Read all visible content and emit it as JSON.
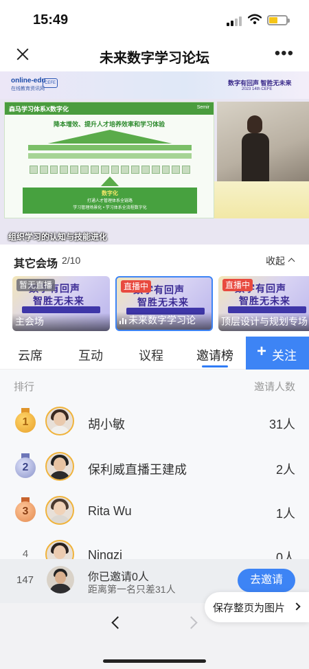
{
  "status_bar": {
    "time": "15:49"
  },
  "nav": {
    "title": "未来数字学习论坛",
    "more_label": "•••"
  },
  "video": {
    "logo": "online-edu",
    "logo_sub": "在线教育资讯网",
    "logo_badge": "CEFE",
    "banner_title": "数字有回声  智胜无未来",
    "banner_sub": "2023 14th CEFE",
    "slide_header": "森马学习体系X数字化",
    "slide_brand": "Semir",
    "slide_title": "降本增效、提升人才培养效率和学习体验",
    "slide_box_title": "数字化",
    "slide_box_line1": "打通人才管理体系全链路",
    "slide_box_line2": "学习管理场景化 • 学习体系全流程数字化",
    "caption": "组织学习的认知与技能进化"
  },
  "venues": {
    "title": "其它会场",
    "count": "2/10",
    "collapse_label": "收起",
    "items": [
      {
        "badge": "暂无直播",
        "name": "主会场",
        "art1": "数字有回声",
        "art2": "智胜无未来"
      },
      {
        "badge": "直播中",
        "name": "未来数字学习论",
        "art1": "数字有回声",
        "art2": "智胜无未来"
      },
      {
        "badge": "直播中",
        "name": "顶层设计与规划专场",
        "art1": "数字有回声",
        "art2": "智胜无未来"
      }
    ]
  },
  "tabs": [
    {
      "label": "云席"
    },
    {
      "label": "互动"
    },
    {
      "label": "议程"
    },
    {
      "label": "邀请榜"
    }
  ],
  "follow_button": {
    "plus": "+",
    "label": "关注"
  },
  "ranking": {
    "header_left": "排行",
    "header_right": "邀请人数",
    "rows": [
      {
        "rank": "1",
        "name": "胡小敏",
        "count": "31人"
      },
      {
        "rank": "2",
        "name": "保利威直播王建成",
        "count": "2人"
      },
      {
        "rank": "3",
        "name": "Rita Wu",
        "count": "1人"
      },
      {
        "rank": "4",
        "name": "Ningzi",
        "count": "0人"
      }
    ]
  },
  "my_invite": {
    "rank": "147",
    "title": "你已邀请0人",
    "subtitle": "距离第一名只差31人",
    "button": "去邀请"
  },
  "save_page": {
    "label": "保存整页为图片"
  },
  "colors": {
    "accent": "#3d84f5",
    "live_red": "#e84a3f",
    "gold": "#f0b33b",
    "silver": "#8a93c9",
    "bronze": "#e38a4f"
  }
}
